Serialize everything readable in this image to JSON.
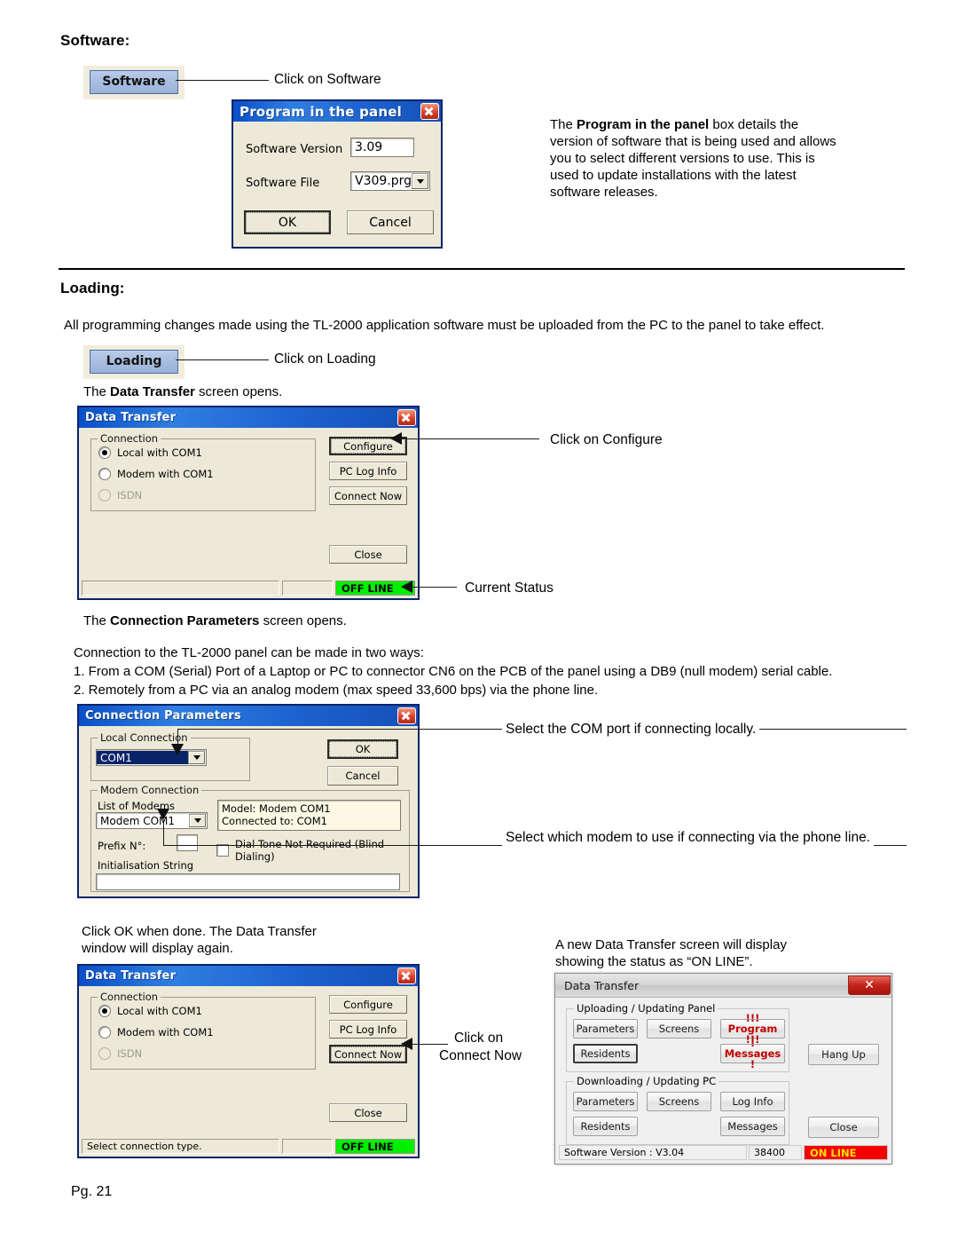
{
  "sections": {
    "software_heading": "Software:",
    "loading_heading": "Loading:"
  },
  "ribbon": {
    "software_button": "Software",
    "loading_button": "Loading"
  },
  "callouts": {
    "click_software": "Click on Software",
    "click_loading": "Click on Loading",
    "click_configure": "Click on Configure",
    "current_status": "Current Status",
    "select_com_port": "Select the COM port if connecting locally.",
    "select_modem": "Select which modem to use if connecting via the phone line.",
    "click_connect_now_line1": "Click on",
    "click_connect_now_line2": "Connect Now"
  },
  "paragraphs": {
    "program_panel_pre": "The ",
    "program_panel_bold": "Program in the panel",
    "program_panel_post": " box details the version of software that is being used and allows you to select different versions to use. This is used to update installations with the latest software releases.",
    "loading_intro": "All programming changes made using the TL-2000 application software must be uploaded from the PC to the panel to take effect.",
    "data_transfer_opens_pre": "The ",
    "data_transfer_opens_bold": "Data Transfer",
    "data_transfer_opens_post": " screen opens.",
    "conn_params_opens_pre": "The ",
    "conn_params_opens_bold": "Connection Parameters",
    "conn_params_opens_post": " screen opens.",
    "two_ways": "Connection to the TL-2000 panel can be made in two ways:",
    "way_1": "1.  From a COM (Serial) Port of a Laptop or PC to connector CN6 on the PCB of the panel using a DB9 (null modem) serial cable.",
    "way_2": "2.  Remotely from a PC via an analog modem (max speed 33,600 bps) via the phone line.",
    "click_ok_when_done": "Click OK when done. The Data Transfer window will display again.",
    "new_screen_online": "A new Data Transfer screen will display showing the status as “ON LINE”."
  },
  "program_dialog": {
    "title": "Program in the panel",
    "close_icon": "close-icon",
    "software_version_label": "Software Version",
    "software_version_value": "3.09",
    "software_file_label": "Software File",
    "software_file_value": "V309.prg",
    "dropdown_icon": "chevron-down-icon",
    "ok": "OK",
    "cancel": "Cancel"
  },
  "data_transfer_1": {
    "title": "Data Transfer",
    "close_icon": "close-icon",
    "group_connection": "Connection",
    "radios": [
      {
        "label": "Local with COM1",
        "checked": true,
        "disabled": false
      },
      {
        "label": "Modem with COM1",
        "checked": false,
        "disabled": false
      },
      {
        "label": "ISDN",
        "checked": false,
        "disabled": true
      }
    ],
    "buttons": {
      "configure": "Configure",
      "pc_log_info": "PC Log Info",
      "connect_now": "Connect Now",
      "close": "Close"
    },
    "status": {
      "message": "",
      "middle": "",
      "state": "OFF LINE",
      "state_color": "#00ee00"
    }
  },
  "connection_parameters": {
    "title": "Connection Parameters",
    "close_icon": "close-icon",
    "group_local": "Local Connection",
    "local_port_value": "COM1",
    "group_modem": "Modem Connection",
    "list_of_modems_label": "List of Modems",
    "list_of_modems_value": "Modem COM1",
    "modem_info_line1": "Model: Modem COM1",
    "modem_info_line2": "Connected to: COM1",
    "prefix_label": "Prefix N°:",
    "prefix_value": "",
    "dial_tone_label": "Dial Tone Not Required (Blind Dialing)",
    "init_string_label": "Initialisation String",
    "init_string_value": "",
    "ok": "OK",
    "cancel": "Cancel",
    "dropdown_icon": "chevron-down-icon"
  },
  "data_transfer_2": {
    "title": "Data Transfer",
    "close_icon": "close-icon",
    "group_connection": "Connection",
    "radios": [
      {
        "label": "Local with COM1",
        "checked": true,
        "disabled": false
      },
      {
        "label": "Modem with COM1",
        "checked": false,
        "disabled": false
      },
      {
        "label": "ISDN",
        "checked": false,
        "disabled": true
      }
    ],
    "buttons": {
      "configure": "Configure",
      "pc_log_info": "PC Log Info",
      "connect_now": "Connect Now",
      "close": "Close"
    },
    "status": {
      "message": "Select connection type.",
      "middle": "",
      "state": "OFF LINE",
      "state_color": "#00ee00"
    }
  },
  "data_transfer_online": {
    "title": "Data Transfer",
    "close_icon": "close-icon",
    "group_upload": "Uploading / Updating Panel",
    "upload_buttons": {
      "parameters": "Parameters",
      "screens": "Screens",
      "program": "!!! Program !!!",
      "residents": "Residents",
      "messages": "! Messages !"
    },
    "group_download": "Downloading / Updating PC",
    "download_buttons": {
      "parameters": "Parameters",
      "screens": "Screens",
      "log_info": "Log Info",
      "residents": "Residents",
      "messages": "Messages"
    },
    "hang_up": "Hang Up",
    "close": "Close",
    "status": {
      "software_version": "Software Version : V3.04",
      "baud": "38400",
      "state": "ON LINE",
      "state_color": "#f50000"
    }
  },
  "footer": {
    "page": "Pg. 21"
  }
}
